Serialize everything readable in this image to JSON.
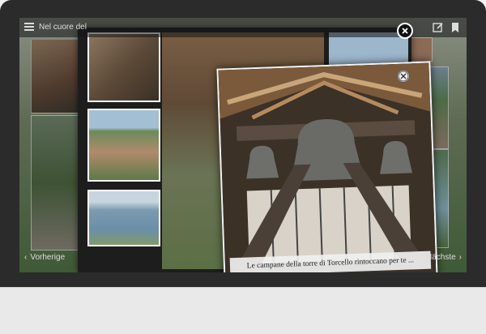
{
  "header": {
    "title": "Nel cuore del",
    "menu_icon": "hamburger-menu-icon",
    "edit_icon": "edit-icon",
    "bookmark_icon": "bookmark-icon"
  },
  "lightbox": {
    "caption": "Le campane della torre di Torcello rintoccano per te ...",
    "close_icon": "close-icon"
  },
  "navigation": {
    "prev_label": "Vorherige",
    "next_label": "Nächste"
  }
}
